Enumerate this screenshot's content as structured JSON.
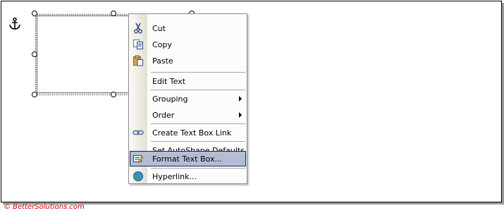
{
  "menu": {
    "items": [
      {
        "label": "Cut",
        "icon": "scissors-icon"
      },
      {
        "label": "Copy",
        "icon": "copy-icon"
      },
      {
        "label": "Paste",
        "icon": "paste-icon"
      },
      {
        "label": "Edit Text",
        "icon": ""
      },
      {
        "label": "Grouping",
        "icon": "",
        "submenu": true
      },
      {
        "label": "Order",
        "icon": "",
        "submenu": true
      },
      {
        "label": "Create Text Box Link",
        "icon": "link-icon"
      },
      {
        "label": "Set AutoShape Defaults",
        "icon": ""
      },
      {
        "label": "Format Text Box...",
        "icon": "format-textbox-icon",
        "highlighted": true
      },
      {
        "label": "Hyperlink...",
        "icon": "globe-icon"
      }
    ]
  },
  "footer": {
    "copyright": "© BetterSolutions.com"
  },
  "colors": {
    "highlight": "#b6bdd2",
    "highlight_border": "#0a246a",
    "footer_text": "#cc0000"
  }
}
